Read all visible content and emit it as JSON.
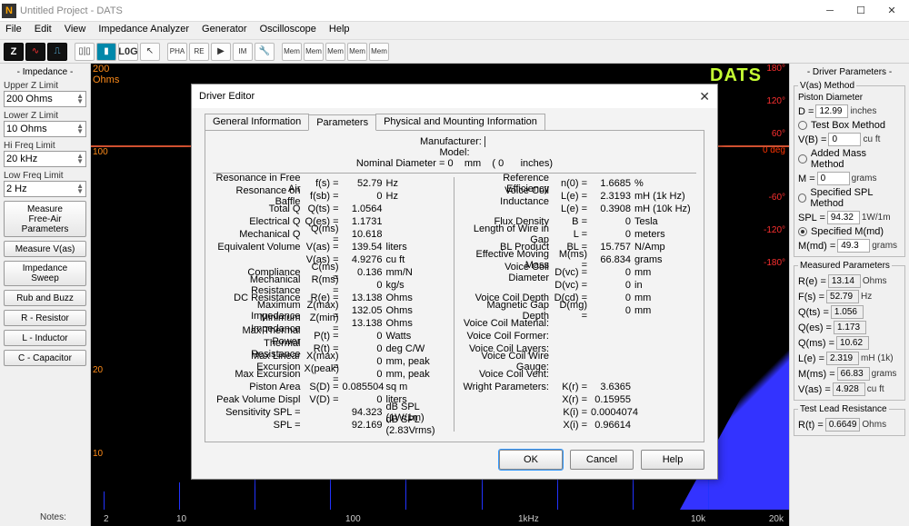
{
  "window": {
    "title": "Untitled Project - DATS"
  },
  "menu": [
    "File",
    "Edit",
    "View",
    "Impedance Analyzer",
    "Generator",
    "Oscilloscope",
    "Help"
  ],
  "plot": {
    "brand": "DATS",
    "yL_label": "Ohms",
    "yL": [
      "200",
      "100",
      "20",
      "10"
    ],
    "yR": [
      "180°",
      "120°",
      "60°",
      "0 deg",
      "-60°",
      "-120°",
      "-180°"
    ],
    "x": [
      "2",
      "10",
      "100",
      "1kHz",
      "10k",
      "20k"
    ]
  },
  "left": {
    "head": "- Impedance -",
    "upperZ": {
      "label": "Upper Z Limit",
      "value": "200 Ohms"
    },
    "lowerZ": {
      "label": "Lower Z Limit",
      "value": "10 Ohms"
    },
    "hiF": {
      "label": "Hi Freq Limit",
      "value": "20 kHz"
    },
    "loF": {
      "label": "Low Freq Limit",
      "value": "2 Hz"
    },
    "btn1": "Measure\nFree-Air\nParameters",
    "btn2": "Measure V(as)",
    "btn3": "Impedance\nSweep",
    "btn4": "Rub and Buzz",
    "btn5": "R - Resistor",
    "btn6": "L - Inductor",
    "btn7": "C - Capacitor"
  },
  "right": {
    "head": "- Driver Parameters -",
    "vas_legend": "V(as) Method",
    "pd_label": "Piston Diameter",
    "D": {
      "sym": "D =",
      "val": "12.99",
      "unit": "inches"
    },
    "tbm": "Test Box Method",
    "VB": {
      "sym": "V(B) =",
      "val": "0",
      "unit": "cu ft"
    },
    "amm": "Added Mass Method",
    "M": {
      "sym": "M =",
      "val": "0",
      "unit": "grams"
    },
    "ssm": "Specified SPL Method",
    "SPL": {
      "sym": "SPL =",
      "val": "94.32",
      "unit": "1W/1m"
    },
    "smm": "Specified M(md)",
    "Mmd": {
      "sym": "M(md) =",
      "val": "49.3",
      "unit": "grams"
    },
    "mp_legend": "Measured Parameters",
    "Re": {
      "sym": "R(e) =",
      "val": "13.14",
      "unit": "Ohms"
    },
    "Fs": {
      "sym": "F(s) =",
      "val": "52.79",
      "unit": "Hz"
    },
    "Qts": {
      "sym": "Q(ts) =",
      "val": "1.056"
    },
    "Qes": {
      "sym": "Q(es) =",
      "val": "1.173"
    },
    "Qms": {
      "sym": "Q(ms) =",
      "val": "10.62"
    },
    "Le": {
      "sym": "L(e) =",
      "val": "2.319",
      "unit": "mH (1k)"
    },
    "Mms": {
      "sym": "M(ms) =",
      "val": "66.83",
      "unit": "grams"
    },
    "Vas": {
      "sym": "V(as) =",
      "val": "4.928",
      "unit": "cu ft"
    },
    "tlr_legend": "Test Lead Resistance",
    "Rt": {
      "sym": "R(t) =",
      "val": "0.6649",
      "unit": "Ohms"
    }
  },
  "notes_label": "Notes:",
  "modal": {
    "title": "Driver Editor",
    "tabs": [
      "General Information",
      "Parameters",
      "Physical and Mounting Information"
    ],
    "top": {
      "manufacturer_label": "Manufacturer:",
      "model_label": "Model:",
      "nd_label": "Nominal Diameter =",
      "nd_val": "0",
      "nd_unit1": "mm",
      "nd_paren": "( 0",
      "nd_unit2": "inches)"
    },
    "buttons": {
      "ok": "OK",
      "cancel": "Cancel",
      "help": "Help"
    },
    "left_rows": [
      {
        "l": "Resonance in Free Air",
        "m": "f(s) =",
        "v": "52.79",
        "u": "Hz"
      },
      {
        "l": "Resonance on Baffle",
        "m": "f(sb) =",
        "v": "0",
        "u": "Hz"
      },
      {
        "l": "Total Q",
        "m": "Q(ts) =",
        "v": "1.0564",
        "u": ""
      },
      {
        "l": "Electrical Q",
        "m": "Q(es) =",
        "v": "1.1731",
        "u": ""
      },
      {
        "l": "Mechanical Q",
        "m": "Q(ms) =",
        "v": "10.618",
        "u": ""
      },
      {
        "l": "Equivalent Volume",
        "m": "V(as) =",
        "v": "139.54",
        "u": "liters"
      },
      {
        "l": "",
        "m": "V(as) =",
        "v": "4.9276",
        "u": "cu ft"
      },
      {
        "l": "Compliance",
        "m": "C(ms) =",
        "v": "0.136",
        "u": "mm/N"
      },
      {
        "l": "Mechanical Resistance",
        "m": "R(ms) =",
        "v": "0",
        "u": "kg/s"
      },
      {
        "l": "DC Resistance",
        "m": "R(e) =",
        "v": "13.138",
        "u": "Ohms"
      },
      {
        "l": "Maximum Impedance",
        "m": "Z(max) =",
        "v": "132.05",
        "u": "Ohms"
      },
      {
        "l": "Minimum Impedance",
        "m": "Z(min) =",
        "v": "13.138",
        "u": "Ohms"
      },
      {
        "l": "Max Thermal Power",
        "m": "P(t) =",
        "v": "0",
        "u": "Watts"
      },
      {
        "l": "Thermal Resistance",
        "m": "R(t) =",
        "v": "0",
        "u": "deg C/W"
      },
      {
        "l": "Max Linear Excursion",
        "m": "X(max) =",
        "v": "0",
        "u": "mm, peak"
      },
      {
        "l": "Max Excursion",
        "m": "X(peak) =",
        "v": "0",
        "u": "mm, peak"
      },
      {
        "l": "Piston Area",
        "m": "S(D) =",
        "v": "0.085504",
        "u": "sq m"
      },
      {
        "l": "Peak Volume Displ",
        "m": "V(D) =",
        "v": "0",
        "u": "liters"
      },
      {
        "l": "Sensitivity         SPL =",
        "m": "",
        "v": "94.323",
        "u": "dB SPL (1W/1m)"
      },
      {
        "l": "SPL =",
        "m": "",
        "v": "92.169",
        "u": "dB SPL (2.83Vrms)"
      }
    ],
    "right_rows": [
      {
        "l": "Reference Efficiency",
        "m": "n(0) =",
        "v": "1.6685",
        "u": "%"
      },
      {
        "l": "Voice Coil Inductance",
        "m": "L(e) =",
        "v": "2.3193",
        "u": "mH (1k Hz)"
      },
      {
        "l": "",
        "m": "L(e) =",
        "v": "0.3908",
        "u": "mH (10k Hz)"
      },
      {
        "l": "Flux Density",
        "m": "B =",
        "v": "0",
        "u": "Tesla"
      },
      {
        "l": "Length of Wire in Gap",
        "m": "L =",
        "v": "0",
        "u": "meters"
      },
      {
        "l": "BL Product",
        "m": "BL =",
        "v": "15.757",
        "u": "N/Amp"
      },
      {
        "l": "Effective Moving Mass",
        "m": "M(ms) =",
        "v": "66.834",
        "u": "grams"
      },
      {
        "l": "Voice Coil Diameter",
        "m": "D(vc) =",
        "v": "0",
        "u": "mm"
      },
      {
        "l": "",
        "m": "D(vc) =",
        "v": "0",
        "u": "in"
      },
      {
        "l": "Voice Coil Depth",
        "m": "D(cd) =",
        "v": "0",
        "u": "mm"
      },
      {
        "l": "Magnetic Gap Depth",
        "m": "D(mg) =",
        "v": "0",
        "u": "mm"
      },
      {
        "l": "Voice Coil Material:",
        "m": "",
        "v": "",
        "u": ""
      },
      {
        "l": "Voice Coil Former:",
        "m": "",
        "v": "",
        "u": ""
      },
      {
        "l": "Voice Coil Layers:",
        "m": "",
        "v": "",
        "u": ""
      },
      {
        "l": "Voice Coil Wire Gauge:",
        "m": "",
        "v": "",
        "u": ""
      },
      {
        "l": "Voice Coil Vent:",
        "m": "",
        "v": "",
        "u": ""
      },
      {
        "l": "Wright Parameters:",
        "m": "K(r) =",
        "v": "3.6365",
        "u": ""
      },
      {
        "l": "",
        "m": "X(r) =",
        "v": "0.15955",
        "u": ""
      },
      {
        "l": "",
        "m": "K(i) =",
        "v": "0.0004074",
        "u": ""
      },
      {
        "l": "",
        "m": "X(i) =",
        "v": "0.96614",
        "u": ""
      }
    ]
  }
}
